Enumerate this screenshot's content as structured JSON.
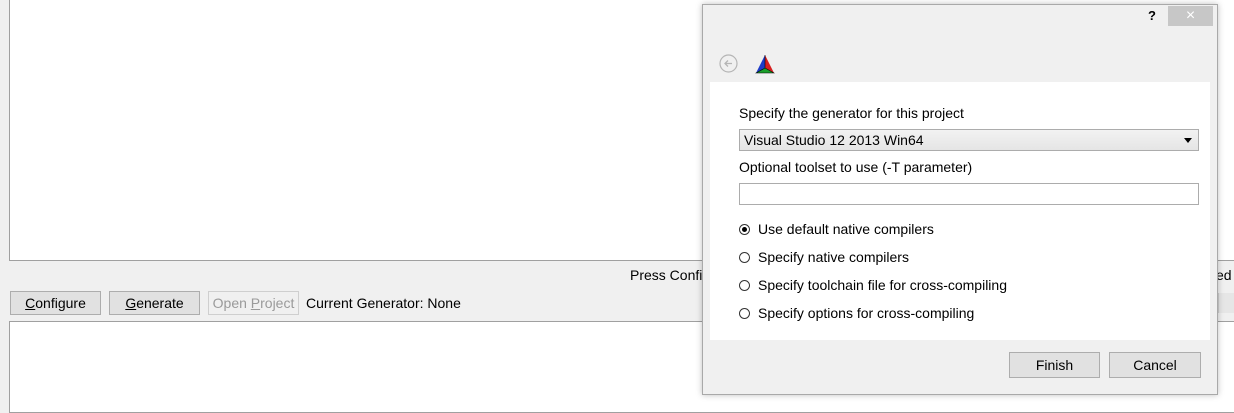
{
  "main": {
    "status_text": "Press Config",
    "status_right": "ed",
    "buttons": {
      "configure": {
        "label_underline": "C",
        "label_rest": "onfigure"
      },
      "generate": {
        "label_underline": "G",
        "label_rest": "enerate"
      },
      "open_project": {
        "label_pre": "Open ",
        "label_underline": "P",
        "label_rest": "roject"
      }
    },
    "current_generator": "Current Generator: None"
  },
  "dialog": {
    "help_glyph": "?",
    "close_glyph": "×",
    "generator_label": "Specify the generator for this project",
    "generator_value": "Visual Studio 12 2013 Win64",
    "toolset_label": "Optional toolset to use (-T parameter)",
    "toolset_value": "",
    "radio_options": [
      {
        "label": "Use default native compilers",
        "checked": true
      },
      {
        "label": "Specify native compilers",
        "checked": false
      },
      {
        "label": "Specify toolchain file for cross-compiling",
        "checked": false
      },
      {
        "label": "Specify options for cross-compiling",
        "checked": false
      }
    ],
    "finish_label": "Finish",
    "cancel_label": "Cancel",
    "icons": {
      "back": "back-arrow-icon",
      "logo": "cmake-logo-icon"
    }
  }
}
